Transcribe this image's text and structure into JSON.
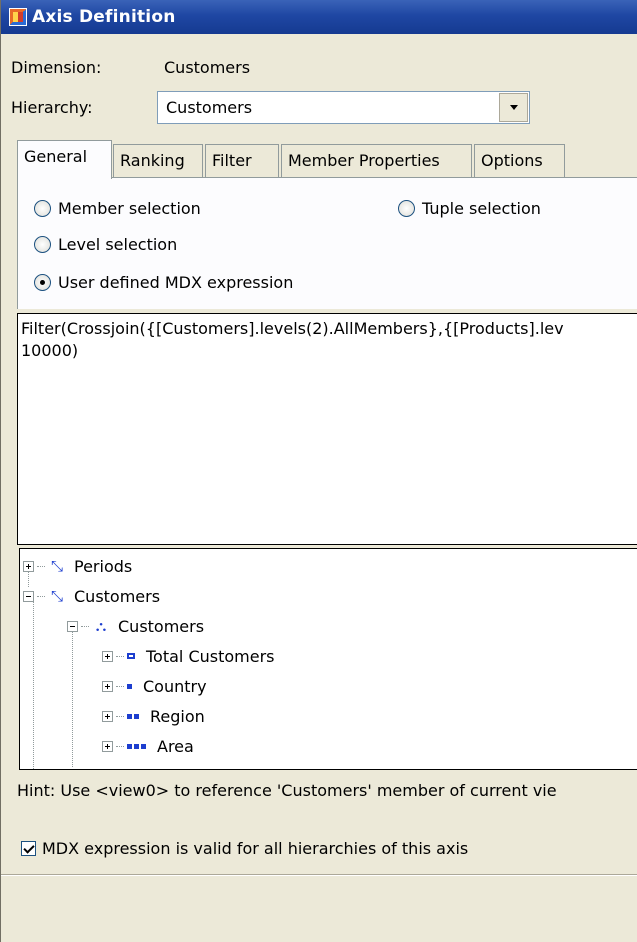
{
  "window": {
    "title": "Axis Definition"
  },
  "dimension": {
    "label": "Dimension:",
    "value": "Customers"
  },
  "hierarchy": {
    "label": "Hierarchy:",
    "value": "Customers"
  },
  "tabs": [
    {
      "label": "General",
      "active": true
    },
    {
      "label": "Ranking",
      "active": false
    },
    {
      "label": "Filter",
      "active": false
    },
    {
      "label": "Member Properties",
      "active": false
    },
    {
      "label": "Options",
      "active": false
    }
  ],
  "selection": {
    "member": "Member selection",
    "tuple": "Tuple selection",
    "level": "Level selection",
    "user_mdx": "User defined MDX expression",
    "selected": "user_mdx"
  },
  "mdx_expression": "Filter(Crossjoin({[Customers].levels(2).AllMembers},{[Products].lev\n10000)",
  "tree": {
    "periods": "Periods",
    "customers_dim": "Customers",
    "customers_hier": "Customers",
    "total_customers": "Total Customers",
    "country": "Country",
    "region": "Region",
    "area": "Area"
  },
  "hint": "Hint: Use  <view0> to reference 'Customers' member of current vie",
  "valid_all_hierarchies": {
    "label": "MDX expression is valid for all hierarchies of this axis",
    "checked": true
  },
  "colors": {
    "title_bar": "#1f47a3",
    "face": "#ece9d8",
    "tree_icon": "#1d3ecf"
  }
}
